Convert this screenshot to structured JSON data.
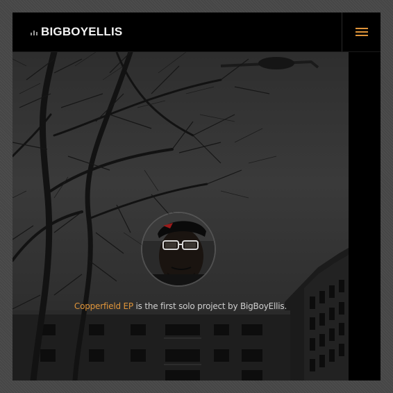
{
  "header": {
    "logo_text": "BIGBOYELLIS",
    "logo_icon": "equalizer-bars-icon",
    "menu_icon": "hamburger-menu-icon"
  },
  "hero": {
    "avatar": "artist-avatar",
    "tagline_link": "Copperfield EP",
    "tagline_rest": " is the first solo project by BigBoyEllis."
  },
  "colors": {
    "accent": "#e0953a",
    "background": "#000000",
    "page_bg": "#4a4a4a",
    "text": "#cfcfcf"
  }
}
